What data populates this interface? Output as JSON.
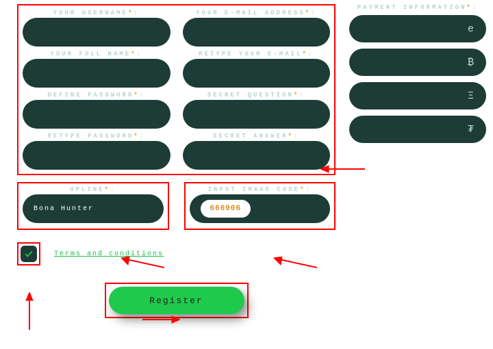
{
  "fields": {
    "username_label": "YOUR USERNAME",
    "email_label": "YOUR E-MAIL ADDRESS",
    "fullname_label": "YOUR FULL NAME",
    "retype_email_label": "RETYPE YOUR E-MAIL",
    "password_label": "DEFINE PASSWORD",
    "secret_q_label": "SECRET QUESTION",
    "retype_password_label": "RETYPE PASSWORD",
    "secret_a_label": "SECRET ANSWER"
  },
  "upline": {
    "label": "UPLINE",
    "value": "Bona Hunter"
  },
  "captcha": {
    "label": "INPUT IMAGE CODE",
    "value": "666906"
  },
  "terms": {
    "link": "Terms and conditions"
  },
  "register_label": "Register",
  "payment": {
    "label": "PAYMENT INFORMATION",
    "options": [
      "e",
      "₿",
      "Ξ",
      "₮"
    ]
  }
}
